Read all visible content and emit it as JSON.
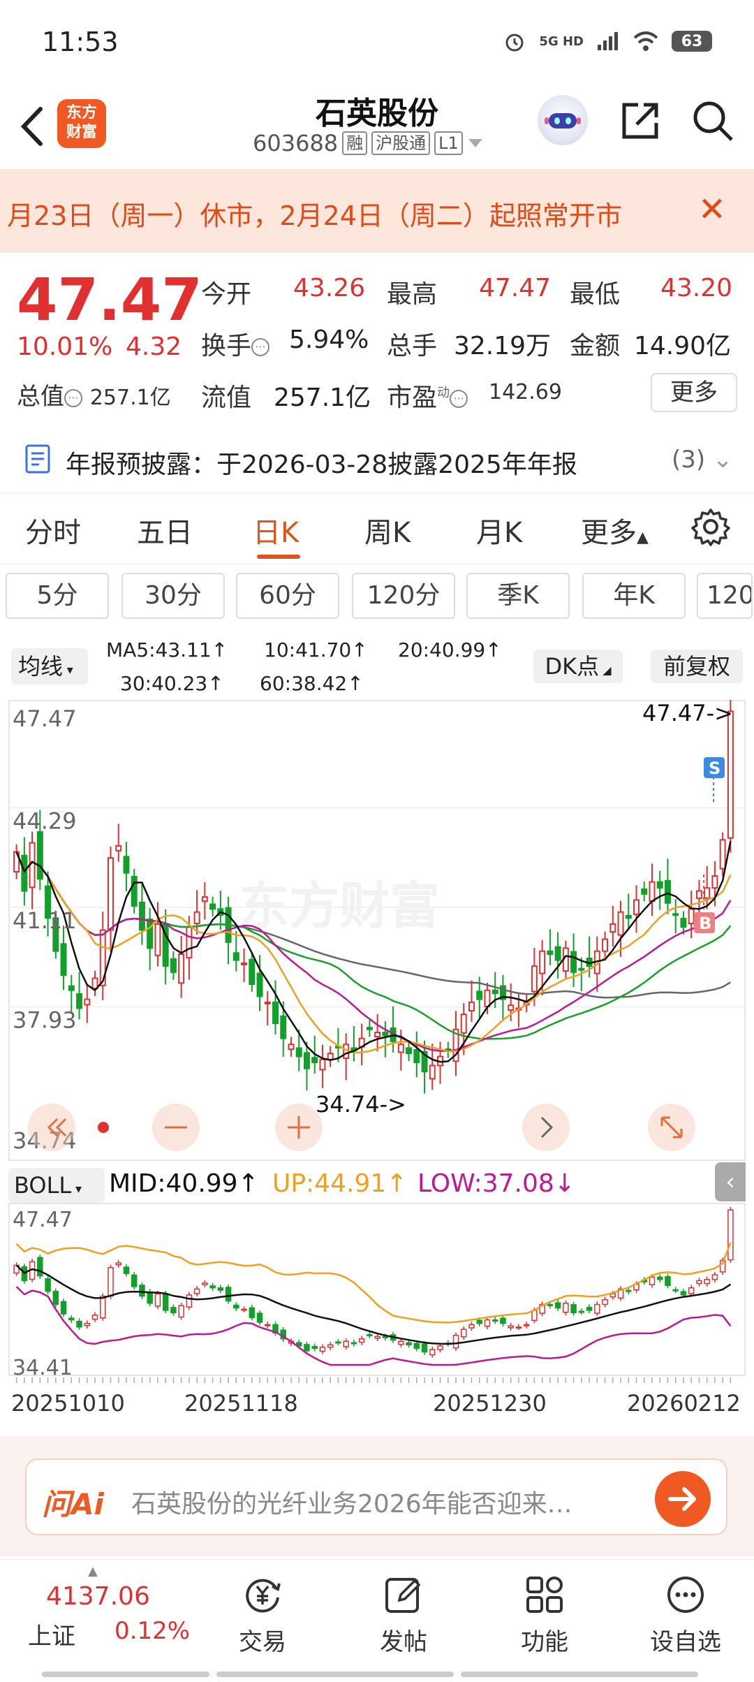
{
  "status_bar": {
    "time": "11:53",
    "network": "5G HD",
    "battery": "63"
  },
  "header": {
    "stock_name": "石英股份",
    "stock_code": "603688",
    "tags": [
      "融",
      "沪股通",
      "L1"
    ],
    "logo_text": [
      "东方",
      "财富"
    ]
  },
  "notice": {
    "text": "月23日（周一）休市，2月24日（周二）起照常开市"
  },
  "quote": {
    "price": "47.47",
    "change_pct": "10.01%",
    "change": "4.32",
    "fields": [
      {
        "label": "今开",
        "value": "43.26",
        "color": "red"
      },
      {
        "label": "最高",
        "value": "47.47",
        "color": "red"
      },
      {
        "label": "最低",
        "value": "43.20",
        "color": "red"
      },
      {
        "label": "换手",
        "value": "5.94%",
        "color": "black"
      },
      {
        "label": "总手",
        "value": "32.19万",
        "color": "black"
      },
      {
        "label": "金额",
        "value": "14.90亿",
        "color": "black"
      },
      {
        "label": "流值",
        "value": "257.1亿",
        "color": "black"
      },
      {
        "label": "市盈",
        "value": "142.69",
        "color": "black"
      }
    ],
    "total_cap_label": "总值",
    "total_cap_value": "257.1亿",
    "pe_sup": "动",
    "more_label": "更多"
  },
  "report": {
    "text": "年报预披露：于2026-03-28披露2025年年报",
    "count": "(3)"
  },
  "period_tabs": [
    "分时",
    "五日",
    "日K",
    "周K",
    "月K",
    "更多"
  ],
  "active_period": "日K",
  "chips": [
    "5分",
    "30分",
    "60分",
    "120分",
    "季K",
    "年K",
    "120"
  ],
  "ma_legend": {
    "selector": "均线",
    "items": [
      {
        "text": "MA5:43.11↑",
        "color": "#111111"
      },
      {
        "text": "10:41.70↑",
        "color": "#f0a020"
      },
      {
        "text": "20:40.99↑",
        "color": "#c01890"
      },
      {
        "text": "30:40.23↑",
        "color": "#18a028"
      },
      {
        "text": "60:38.42↑",
        "color": "#666666"
      }
    ],
    "dk_label": "DK点",
    "fq_label": "前复权"
  },
  "main_chart_labels": {
    "y_ticks": [
      "47.47",
      "44.29",
      "41.11",
      "37.93",
      "34.74"
    ],
    "high_marker": "47.47->",
    "low_marker": "34.74->",
    "watermark": "东方财富",
    "s_marker": "S",
    "b_marker": "B"
  },
  "boll_legend": {
    "selector": "BOLL",
    "mid": "MID:40.99↑",
    "up": "UP:44.91↑",
    "low": "LOW:37.08↓"
  },
  "boll_labels": {
    "top": "47.47",
    "bottom": "34.41"
  },
  "date_axis": [
    "20251010",
    "20251118",
    "20251230",
    "20260212"
  ],
  "chart_data": {
    "type": "candlestick",
    "ylim": [
      34.74,
      47.47
    ],
    "closes": [
      42.8,
      41.5,
      43.1,
      41.9,
      40.6,
      39.5,
      38.7,
      38.2,
      37.6,
      37.9,
      38.6,
      40.2,
      42.6,
      43.0,
      42.1,
      41.0,
      40.2,
      39.6,
      40.4,
      39.0,
      38.8,
      39.4,
      40.3,
      40.8,
      41.3,
      40.9,
      40.7,
      39.8,
      39.2,
      39.1,
      38.4,
      38.0,
      37.8,
      37.1,
      36.6,
      36.4,
      36.0,
      35.6,
      35.8,
      35.9,
      36.1,
      36.3,
      36.4,
      36.2,
      36.6,
      36.9,
      36.8,
      36.7,
      36.5,
      36.4,
      36.1,
      35.8,
      35.5,
      35.7,
      36.0,
      36.2,
      36.9,
      37.4,
      37.8,
      37.9,
      38.2,
      38.1,
      37.9,
      37.7,
      37.6,
      37.8,
      39.0,
      39.5,
      39.4,
      39.2,
      39.6,
      38.8,
      38.9,
      39.0,
      39.5,
      39.9,
      40.4,
      40.8,
      40.6,
      41.2,
      41.4,
      41.8,
      41.6,
      41.1,
      40.7,
      40.3,
      40.9,
      41.5,
      41.6,
      42.0,
      43.2,
      47.47
    ],
    "ma5_last": 43.11,
    "ma10_last": 41.7,
    "ma20_last": 40.99,
    "ma30_last": 40.23,
    "ma60_last": 38.42,
    "boll": {
      "mid": 40.99,
      "up": 44.91,
      "low": 37.08
    }
  },
  "ai_bar": {
    "logo": "问Ai",
    "placeholder": "石英股份的光纤业务2026年能否迎来…"
  },
  "bottom_bar": {
    "index_value": "4137.06",
    "index_name": "上证",
    "index_pct": "0.12%",
    "nav": [
      "交易",
      "发帖",
      "功能",
      "设自选"
    ]
  }
}
